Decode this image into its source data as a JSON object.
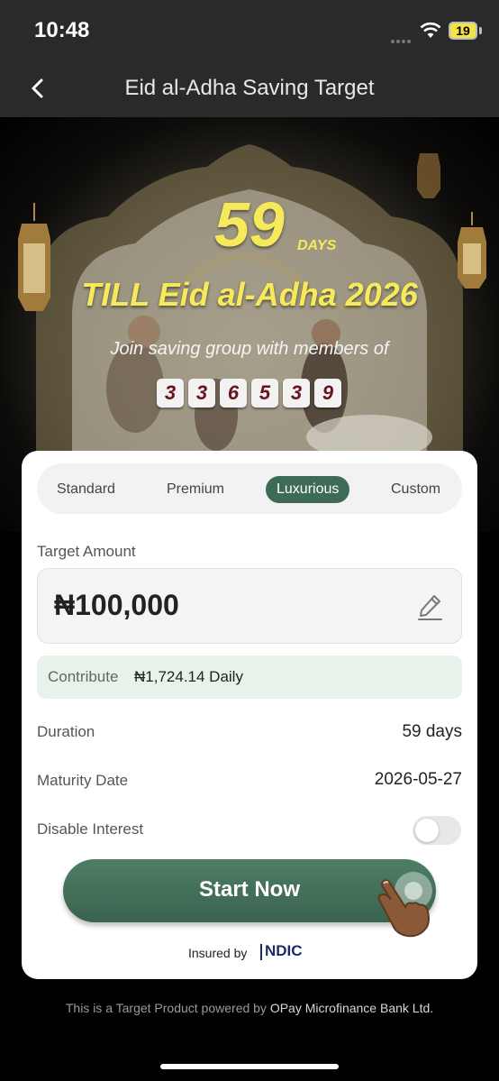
{
  "status_bar": {
    "time": "10:48",
    "battery": "19"
  },
  "nav": {
    "title": "Eid al-Adha Saving Target",
    "back_icon": "chevron-left-icon"
  },
  "banner": {
    "days_count": "59",
    "days_label": "DAYS",
    "till_text": "TILL Eid al-Adha 2026",
    "join_text": "Join saving group with members of",
    "member_digits": [
      "3",
      "3",
      "6",
      "5",
      "3",
      "9"
    ],
    "accent_color": "#f7ea5a"
  },
  "tabs": [
    {
      "label": "Standard",
      "active": false
    },
    {
      "label": "Premium",
      "active": false
    },
    {
      "label": "Luxurious",
      "active": true
    },
    {
      "label": "Custom",
      "active": false
    }
  ],
  "target": {
    "label": "Target Amount",
    "value": "₦100,000",
    "edit_icon": "pencil-icon"
  },
  "contribute": {
    "label": "Contribute",
    "value": "₦1,724.14 Daily"
  },
  "duration": {
    "label": "Duration",
    "value": "59 days"
  },
  "maturity": {
    "label": "Maturity Date",
    "value": "2026-05-27"
  },
  "interest": {
    "label": "Disable Interest",
    "enabled": false
  },
  "start_button": {
    "label": "Start Now",
    "color": "#3d6b56"
  },
  "insured": {
    "prefix": "Insured by",
    "logo_text": "NDIC"
  },
  "footer": {
    "prefix": "This is a Target Product powered by",
    "highlight": "OPay Microfinance Bank Ltd."
  }
}
